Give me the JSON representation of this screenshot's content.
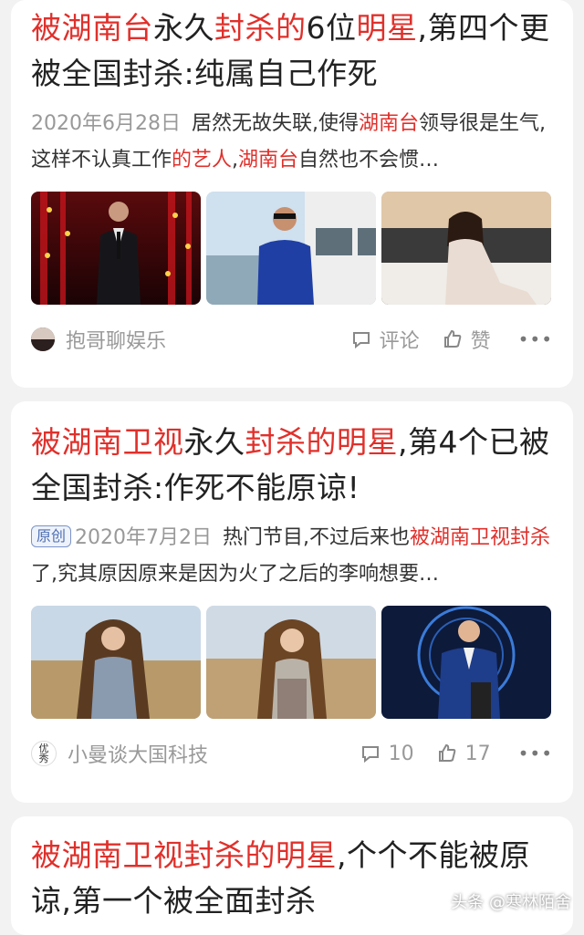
{
  "articles": [
    {
      "title_parts": [
        {
          "text": "被湖南台",
          "hl": true
        },
        {
          "text": "永久",
          "hl": false
        },
        {
          "text": "封杀的",
          "hl": true
        },
        {
          "text": "6位",
          "hl": false
        },
        {
          "text": "明星",
          "hl": true
        },
        {
          "text": ",第四个更被全国封杀:纯属自己作死",
          "hl": false
        }
      ],
      "original_badge": "",
      "date": "2020年6月28日",
      "summary_parts": [
        {
          "text": "居然无故失联,使得",
          "hl": false
        },
        {
          "text": "湖南台",
          "hl": true
        },
        {
          "text": "领导很是生气,这样不认真工作",
          "hl": false
        },
        {
          "text": "的艺人",
          "hl": true
        },
        {
          "text": ",",
          "hl": false
        },
        {
          "text": "湖南台",
          "hl": true
        },
        {
          "text": "自然也不会惯…",
          "hl": false
        }
      ],
      "author": "抱哥聊娱乐",
      "comment_label": "评论",
      "like_label": "赞",
      "more": "•••"
    },
    {
      "title_parts": [
        {
          "text": "被湖南卫视",
          "hl": true
        },
        {
          "text": "永久",
          "hl": false
        },
        {
          "text": "封杀的明星",
          "hl": true
        },
        {
          "text": ",第4个已被全国封杀:作死不能原谅!",
          "hl": false
        }
      ],
      "original_badge": "原创",
      "date": "2020年7月2日",
      "summary_parts": [
        {
          "text": "热门节目,不过后来也",
          "hl": false
        },
        {
          "text": "被湖南卫视封杀",
          "hl": true
        },
        {
          "text": "了,究其原因原来是因为火了之后的李响想要…",
          "hl": false
        }
      ],
      "author": "小曼谈大国科技",
      "avatar_text": "优\n秀",
      "comment_label": "10",
      "like_label": "17",
      "more": "•••"
    },
    {
      "title_parts": [
        {
          "text": "被湖南卫视封杀的明星",
          "hl": true
        },
        {
          "text": ",个个不能被原谅,第一个被全面封杀",
          "hl": false
        }
      ]
    }
  ],
  "watermark": "头条 @寒林陌舍",
  "colors": {
    "highlight": "#e0302b",
    "background": "#f2f2f2",
    "card": "#ffffff"
  }
}
